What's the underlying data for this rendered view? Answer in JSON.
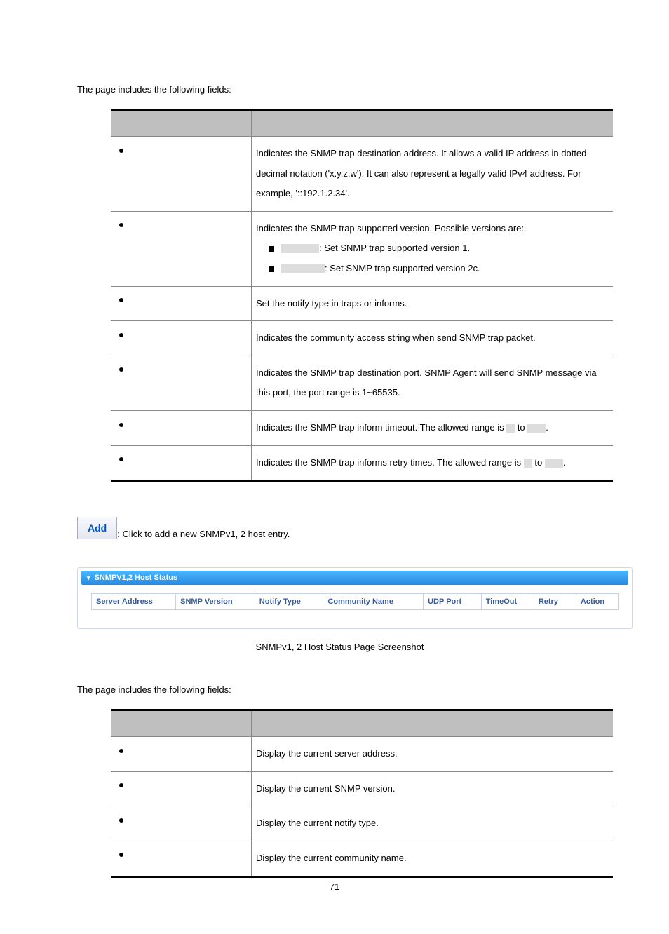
{
  "intro1": "The page includes the following fields:",
  "table1": {
    "rows": [
      {
        "object_has_bullet": true,
        "desc": "Indicates the SNMP trap destination address. It allows a valid IP address in dotted decimal notation ('x.y.z.w'). It can also represent a legally valid IPv4 address. For example, '::192.1.2.34'."
      },
      {
        "object_has_bullet": true,
        "desc_line1": "Indicates the SNMP trap supported version. Possible versions are:",
        "sub_a_suffix": ": Set SNMP trap supported version 1.",
        "sub_b_suffix": ": Set SNMP trap supported version 2c."
      },
      {
        "object_has_bullet": true,
        "desc": "Set the notify type in traps or informs."
      },
      {
        "object_has_bullet": true,
        "desc": "Indicates the community access string when send SNMP trap packet."
      },
      {
        "object_has_bullet": true,
        "desc": "Indicates the SNMP trap destination port. SNMP Agent will send SNMP message via this port, the port range is 1~65535."
      },
      {
        "object_has_bullet": true,
        "desc_pre": "Indicates the SNMP trap inform timeout. The allowed range is ",
        "desc_mid": " to ",
        "desc_post": "."
      },
      {
        "object_has_bullet": true,
        "desc_pre": "Indicates the SNMP trap informs retry times. The allowed range is ",
        "desc_mid": " to ",
        "desc_post": "."
      }
    ]
  },
  "addbtn": "Add",
  "addtext": ": Click to add a new SNMPv1, 2 host entry.",
  "panel_title": "SNMPV1,2 Host Status",
  "status_cols": {
    "c1": "Server Address",
    "c2": "SNMP Version",
    "c3": "Notify Type",
    "c4": "Community Name",
    "c5": "UDP Port",
    "c6": "TimeOut",
    "c7": "Retry",
    "c8": "Action"
  },
  "caption": "SNMPv1, 2 Host Status Page Screenshot",
  "intro2": "The page includes the following fields:",
  "table2": {
    "rows": [
      {
        "desc": "Display the current server address."
      },
      {
        "desc": "Display the current SNMP version."
      },
      {
        "desc": "Display the current notify type."
      },
      {
        "desc": "Display the current community name."
      }
    ]
  },
  "pagenum": "71"
}
